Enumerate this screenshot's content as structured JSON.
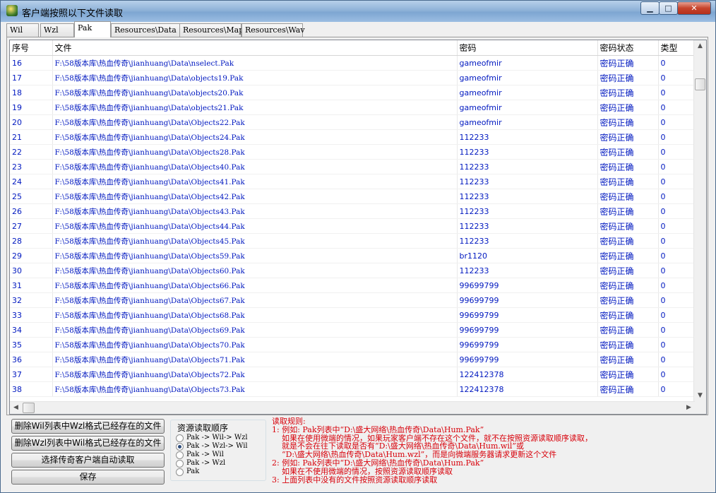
{
  "window": {
    "title": "客户端按照以下文件读取",
    "buttons": {
      "minimize": "▁",
      "maximize": "□",
      "close": "✕"
    }
  },
  "tabs": [
    {
      "label": "Wil",
      "active": false
    },
    {
      "label": "Wzl",
      "active": false
    },
    {
      "label": "Pak",
      "active": true
    },
    {
      "label": "Resources\\Data",
      "active": false
    },
    {
      "label": "Resources\\Map",
      "active": false
    },
    {
      "label": "Resources\\Wav",
      "active": false
    }
  ],
  "table": {
    "columns": [
      "序号",
      "文件",
      "密码",
      "密码状态",
      "类型"
    ],
    "rows": [
      [
        "16",
        "F:\\58版本库\\热血传奇\\jianhuang\\Data\\nselect.Pak",
        "gameofmir",
        "密码正确",
        "0"
      ],
      [
        "17",
        "F:\\58版本库\\热血传奇\\jianhuang\\Data\\objects19.Pak",
        "gameofmir",
        "密码正确",
        "0"
      ],
      [
        "18",
        "F:\\58版本库\\热血传奇\\jianhuang\\Data\\objects20.Pak",
        "gameofmir",
        "密码正确",
        "0"
      ],
      [
        "19",
        "F:\\58版本库\\热血传奇\\jianhuang\\Data\\objects21.Pak",
        "gameofmir",
        "密码正确",
        "0"
      ],
      [
        "20",
        "F:\\58版本库\\热血传奇\\jianhuang\\Data\\Objects22.Pak",
        "gameofmir",
        "密码正确",
        "0"
      ],
      [
        "21",
        "F:\\58版本库\\热血传奇\\jianhuang\\Data\\Objects24.Pak",
        "112233",
        "密码正确",
        "0"
      ],
      [
        "22",
        "F:\\58版本库\\热血传奇\\jianhuang\\Data\\Objects28.Pak",
        "112233",
        "密码正确",
        "0"
      ],
      [
        "23",
        "F:\\58版本库\\热血传奇\\jianhuang\\Data\\Objects40.Pak",
        "112233",
        "密码正确",
        "0"
      ],
      [
        "24",
        "F:\\58版本库\\热血传奇\\jianhuang\\Data\\Objects41.Pak",
        "112233",
        "密码正确",
        "0"
      ],
      [
        "25",
        "F:\\58版本库\\热血传奇\\jianhuang\\Data\\Objects42.Pak",
        "112233",
        "密码正确",
        "0"
      ],
      [
        "26",
        "F:\\58版本库\\热血传奇\\jianhuang\\Data\\Objects43.Pak",
        "112233",
        "密码正确",
        "0"
      ],
      [
        "27",
        "F:\\58版本库\\热血传奇\\jianhuang\\Data\\Objects44.Pak",
        "112233",
        "密码正确",
        "0"
      ],
      [
        "28",
        "F:\\58版本库\\热血传奇\\jianhuang\\Data\\Objects45.Pak",
        "112233",
        "密码正确",
        "0"
      ],
      [
        "29",
        "F:\\58版本库\\热血传奇\\jianhuang\\Data\\Objects59.Pak",
        "br1120",
        "密码正确",
        "0"
      ],
      [
        "30",
        "F:\\58版本库\\热血传奇\\jianhuang\\Data\\Objects60.Pak",
        "112233",
        "密码正确",
        "0"
      ],
      [
        "31",
        "F:\\58版本库\\热血传奇\\jianhuang\\Data\\Objects66.Pak",
        "99699799",
        "密码正确",
        "0"
      ],
      [
        "32",
        "F:\\58版本库\\热血传奇\\jianhuang\\Data\\Objects67.Pak",
        "99699799",
        "密码正确",
        "0"
      ],
      [
        "33",
        "F:\\58版本库\\热血传奇\\jianhuang\\Data\\Objects68.Pak",
        "99699799",
        "密码正确",
        "0"
      ],
      [
        "34",
        "F:\\58版本库\\热血传奇\\jianhuang\\Data\\Objects69.Pak",
        "99699799",
        "密码正确",
        "0"
      ],
      [
        "35",
        "F:\\58版本库\\热血传奇\\jianhuang\\Data\\Objects70.Pak",
        "99699799",
        "密码正确",
        "0"
      ],
      [
        "36",
        "F:\\58版本库\\热血传奇\\jianhuang\\Data\\Objects71.Pak",
        "99699799",
        "密码正确",
        "0"
      ],
      [
        "37",
        "F:\\58版本库\\热血传奇\\jianhuang\\Data\\Objects72.Pak",
        "122412378",
        "密码正确",
        "0"
      ],
      [
        "38",
        "F:\\58版本库\\热血传奇\\jianhuang\\Data\\Objects73.Pak",
        "122412378",
        "密码正确",
        "0"
      ]
    ]
  },
  "buttons": [
    "删除Wil列表中Wzl格式已经存在的文件",
    "删除Wzl列表中Wil格式已经存在的文件",
    "选择传奇客户端自动读取",
    "保存"
  ],
  "resource_order": {
    "title": "资源读取顺序",
    "options": [
      "Pak -> Wil-> Wzl",
      "Pak -> Wzl-> Wil",
      "Pak -> Wil",
      "Pak -> Wzl",
      "Pak"
    ],
    "selected_index": 1
  },
  "rules": [
    "读取规则:",
    "1: 例如: Pak列表中“D:\\盛大网络\\热血传奇\\Data\\Hum.Pak”",
    "    如果在使用微端的情况，如果玩家客户端不存在这个文件，就不在按照资源读取顺序读取，",
    "    就是不会在往下读取是否有“D:\\盛大网络\\热血传奇\\Data\\Hum.wil”或",
    "    “D:\\盛大网络\\热血传奇\\Data\\Hum.wzl”，而是向微端服务器请求更新这个文件",
    "2: 例如: Pak列表中“D:\\盛大网络\\热血传奇\\Data\\Hum.Pak”",
    "    如果在不使用微端的情况，按照资源读取顺序读取",
    "3: 上面列表中没有的文件按照资源读取顺序读取"
  ]
}
